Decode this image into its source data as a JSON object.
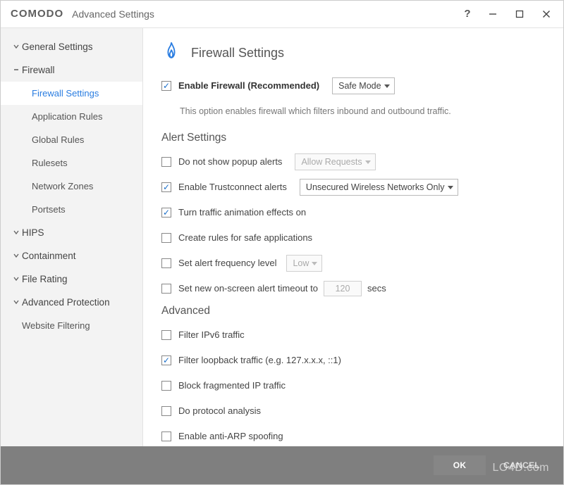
{
  "title": {
    "brand": "COMODO",
    "sub": "Advanced Settings"
  },
  "sidebar": {
    "items": [
      {
        "label": "General Settings",
        "type": "cat",
        "expanded": true
      },
      {
        "label": "Firewall",
        "type": "cat",
        "expanded": true,
        "open": true
      },
      {
        "label": "Firewall Settings",
        "type": "sub",
        "active": true
      },
      {
        "label": "Application Rules",
        "type": "sub"
      },
      {
        "label": "Global Rules",
        "type": "sub"
      },
      {
        "label": "Rulesets",
        "type": "sub"
      },
      {
        "label": "Network Zones",
        "type": "sub"
      },
      {
        "label": "Portsets",
        "type": "sub"
      },
      {
        "label": "HIPS",
        "type": "cat",
        "expanded": true
      },
      {
        "label": "Containment",
        "type": "cat",
        "expanded": true
      },
      {
        "label": "File Rating",
        "type": "cat",
        "expanded": true
      },
      {
        "label": "Advanced Protection",
        "type": "cat",
        "expanded": true
      },
      {
        "label": "Website Filtering",
        "type": "link"
      }
    ]
  },
  "page": {
    "title": "Firewall Settings",
    "enable": {
      "label": "Enable Firewall (Recommended)",
      "checked": true,
      "mode": "Safe Mode"
    },
    "enable_desc": "This option enables firewall which filters inbound and outbound traffic.",
    "alert_header": "Alert Settings",
    "alerts": {
      "no_popup": {
        "label": "Do not show popup alerts",
        "checked": false,
        "dd": "Allow Requests",
        "dd_enabled": false
      },
      "trustconnect": {
        "label": "Enable Trustconnect alerts",
        "checked": true,
        "dd": "Unsecured Wireless Networks Only",
        "dd_enabled": true
      },
      "animation": {
        "label": "Turn traffic animation effects on",
        "checked": true
      },
      "create_rules": {
        "label": "Create rules for safe applications",
        "checked": false
      },
      "alert_freq": {
        "label": "Set alert frequency level",
        "checked": false,
        "dd": "Low",
        "dd_enabled": false
      },
      "alert_timeout": {
        "label": "Set new on-screen alert timeout to",
        "checked": false,
        "value": "120",
        "unit": "secs"
      }
    },
    "advanced_header": "Advanced",
    "advanced": {
      "ipv6": {
        "label": "Filter IPv6 traffic",
        "checked": false
      },
      "loopback": {
        "label": "Filter loopback traffic (e.g. 127.x.x.x, ::1)",
        "checked": true
      },
      "frag": {
        "label": "Block fragmented IP traffic",
        "checked": false
      },
      "protocol": {
        "label": "Do protocol analysis",
        "checked": false
      },
      "arp": {
        "label": "Enable anti-ARP spoofing",
        "checked": false
      }
    }
  },
  "footer": {
    "ok": "OK",
    "cancel": "CANCEL"
  },
  "watermark": "LO4D.com"
}
